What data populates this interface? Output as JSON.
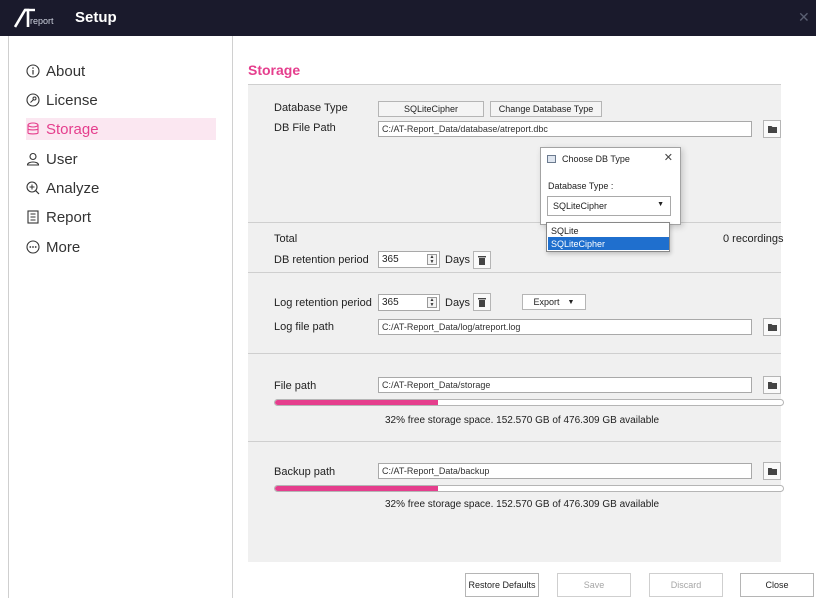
{
  "window": {
    "title": "Setup",
    "logo_sub": "report"
  },
  "sidebar": {
    "items": [
      {
        "label": "About",
        "icon": "info-circle-icon",
        "active": false
      },
      {
        "label": "License",
        "icon": "key-circle-icon",
        "active": false
      },
      {
        "label": "Storage",
        "icon": "database-icon",
        "active": true
      },
      {
        "label": "User",
        "icon": "user-icon",
        "active": false
      },
      {
        "label": "Analyze",
        "icon": "analyze-icon",
        "active": false
      },
      {
        "label": "Report",
        "icon": "report-icon",
        "active": false
      },
      {
        "label": "More",
        "icon": "more-circle-icon",
        "active": false
      }
    ]
  },
  "main": {
    "title": "Storage",
    "db": {
      "type_label": "Database Type",
      "type_value": "SQLiteCipher",
      "change_button": "Change Database Type",
      "path_label": "DB File Path",
      "path_value": "C:/AT-Report_Data/database/atreport.dbc",
      "total_label": "Total",
      "total_value": "0 recordings",
      "retention_label": "DB retention period",
      "retention_value": "365",
      "retention_unit": "Days"
    },
    "log": {
      "retention_label": "Log retention period",
      "retention_value": "365",
      "retention_unit": "Days",
      "export_label": "Export",
      "path_label": "Log file path",
      "path_value": "C:/AT-Report_Data/log/atreport.log"
    },
    "file": {
      "path_label": "File path",
      "path_value": "C:/AT-Report_Data/storage",
      "free_fraction": 0.32,
      "info": "32% free storage space. 152.570 GB of 476.309 GB available"
    },
    "backup": {
      "path_label": "Backup path",
      "path_value": "C:/AT-Report_Data/backup",
      "free_fraction": 0.32,
      "info": "32% free storage space. 152.570 GB of 476.309 GB available"
    }
  },
  "footer": {
    "restore": "Restore Defaults",
    "save": "Save",
    "discard": "Discard",
    "close": "Close"
  },
  "dialog": {
    "title": "Choose DB Type",
    "label": "Database Type :",
    "selected": "SQLiteCipher",
    "options": [
      "SQLite",
      "SQLiteCipher"
    ],
    "highlighted_option": "SQLiteCipher"
  },
  "colors": {
    "accent": "#e53e8d",
    "titlebar": "#1a1a2c",
    "selection": "#1f6fce"
  }
}
